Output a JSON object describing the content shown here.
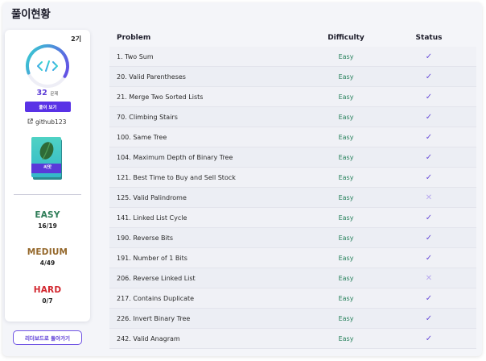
{
  "page": {
    "title": "풀이현황"
  },
  "profile": {
    "generation": "2기",
    "solved": {
      "number": "32",
      "unit": "문제"
    },
    "progress_fraction": 0.64,
    "view_solutions_label": "풀이 보기",
    "github": "github123",
    "badge_label": "씨앗",
    "difficulties": {
      "easy": {
        "label": "EASY",
        "score": "16/19"
      },
      "medium": {
        "label": "MEDIUM",
        "score": "4/49"
      },
      "hard": {
        "label": "HARD",
        "score": "0/7"
      }
    },
    "leaderboard_label": "리더보드로 돌아가기"
  },
  "table": {
    "headers": {
      "problem": "Problem",
      "difficulty": "Difficulty",
      "status": "Status"
    },
    "rows": [
      {
        "problem": "1. Two Sum",
        "difficulty": "Easy",
        "solved": true
      },
      {
        "problem": "20. Valid Parentheses",
        "difficulty": "Easy",
        "solved": true
      },
      {
        "problem": "21. Merge Two Sorted Lists",
        "difficulty": "Easy",
        "solved": true
      },
      {
        "problem": "70. Climbing Stairs",
        "difficulty": "Easy",
        "solved": true
      },
      {
        "problem": "100. Same Tree",
        "difficulty": "Easy",
        "solved": true
      },
      {
        "problem": "104. Maximum Depth of Binary Tree",
        "difficulty": "Easy",
        "solved": true
      },
      {
        "problem": "121. Best Time to Buy and Sell Stock",
        "difficulty": "Easy",
        "solved": true
      },
      {
        "problem": "125. Valid Palindrome",
        "difficulty": "Easy",
        "solved": false
      },
      {
        "problem": "141. Linked List Cycle",
        "difficulty": "Easy",
        "solved": true
      },
      {
        "problem": "190. Reverse Bits",
        "difficulty": "Easy",
        "solved": true
      },
      {
        "problem": "191. Number of 1 Bits",
        "difficulty": "Easy",
        "solved": true
      },
      {
        "problem": "206. Reverse Linked List",
        "difficulty": "Easy",
        "solved": false
      },
      {
        "problem": "217. Contains Duplicate",
        "difficulty": "Easy",
        "solved": true
      },
      {
        "problem": "226. Invert Binary Tree",
        "difficulty": "Easy",
        "solved": true
      },
      {
        "problem": "242. Valid Anagram",
        "difficulty": "Easy",
        "solved": true
      }
    ]
  },
  "colors": {
    "accent": "#5932e6",
    "easy": "#2f7d58",
    "medium": "#94672a",
    "hard": "#d2272f",
    "ring_start": "#6a3de8",
    "ring_end": "#35d3d0"
  },
  "icons": {
    "solved": "check-icon",
    "unsolved": "cross-icon",
    "github": "external-link-icon",
    "profile": "code-icon",
    "badge": "seed-book-icon"
  }
}
